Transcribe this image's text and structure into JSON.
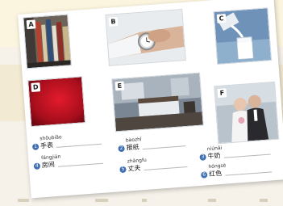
{
  "panels": [
    {
      "letter": "A"
    },
    {
      "letter": "B"
    },
    {
      "letter": "C"
    },
    {
      "letter": "D"
    },
    {
      "letter": "E"
    },
    {
      "letter": "F"
    }
  ],
  "vocabulary": [
    {
      "number": "1",
      "pinyin": "shǒubiǎo",
      "hanzi": "手表"
    },
    {
      "number": "2",
      "pinyin": "bàozhǐ",
      "hanzi": "报纸"
    },
    {
      "number": "3",
      "pinyin": "niúnǎi",
      "hanzi": "牛奶"
    },
    {
      "number": "4",
      "pinyin": "fángjiān",
      "hanzi": "房间"
    },
    {
      "number": "5",
      "pinyin": "zhàngfu",
      "hanzi": "丈夫"
    },
    {
      "number": "6",
      "pinyin": "hóngsè",
      "hanzi": "红色"
    }
  ]
}
